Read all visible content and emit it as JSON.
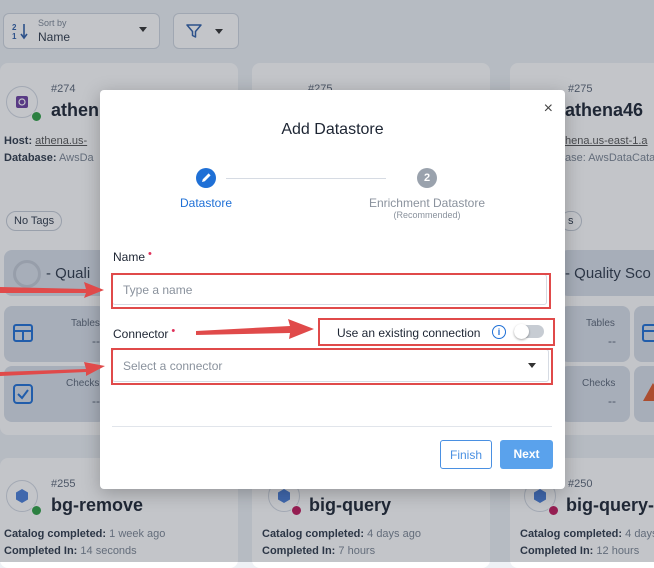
{
  "toolbar": {
    "sort_label": "Sort by",
    "sort_value": "Name"
  },
  "cards_top": [
    {
      "number": "#274",
      "name": "athen",
      "host_label": "Host:",
      "host_value": "athena.us-",
      "db_label": "Database:",
      "db_value": "AwsDa",
      "tag": "No Tags",
      "quality_label": "- Quali",
      "metrics": [
        {
          "label": "Tables",
          "value": "--"
        },
        {
          "label": "Checks",
          "value": "--"
        }
      ]
    },
    {
      "number": "#275",
      "name": "",
      "tag": ""
    },
    {
      "number": "#275",
      "name": "athena46",
      "host_value": "hena.us-east-1.a",
      "db_value": "ase: AwsDataCata",
      "tag": "s",
      "quality_label": "- Quality Sco",
      "metrics": [
        {
          "label": "Tables",
          "value": "--"
        },
        {
          "label": "Checks",
          "value": "--"
        }
      ]
    }
  ],
  "cards_bottom": [
    {
      "number": "#255",
      "name": "bg-remove",
      "catalog_label": "Catalog completed:",
      "catalog_value": "1 week ago",
      "completed_label": "Completed In:",
      "completed_value": "14 seconds"
    },
    {
      "number": "",
      "name": "big-query",
      "catalog_label": "Catalog completed:",
      "catalog_value": "4 days ago",
      "completed_label": "Completed In:",
      "completed_value": "7 hours"
    },
    {
      "number": "#250",
      "name": "big-query-",
      "catalog_label": "Catalog completed:",
      "catalog_value": "4 days ago",
      "completed_label": "Completed In:",
      "completed_value": "12 hours"
    }
  ],
  "modal": {
    "title": "Add Datastore",
    "close_glyph": "×",
    "steps": [
      {
        "label": "Datastore",
        "number": "",
        "sub": ""
      },
      {
        "label": "Enrichment Datastore",
        "number": "2",
        "sub": "(Recommended)"
      }
    ],
    "name_label": "Name",
    "name_required": "•",
    "name_placeholder": "Type a name",
    "connector_label": "Connector",
    "connector_required": "•",
    "existing_connection_label": "Use an existing connection",
    "info_glyph": "i",
    "connector_placeholder": "Select a connector",
    "finish_label": "Finish",
    "next_label": "Next"
  },
  "colors": {
    "primary": "#1f70d6",
    "next_button": "#5aa2ec",
    "annotation_red": "#e04a4a",
    "status_green": "#2ea043",
    "status_red": "#c0185a"
  }
}
